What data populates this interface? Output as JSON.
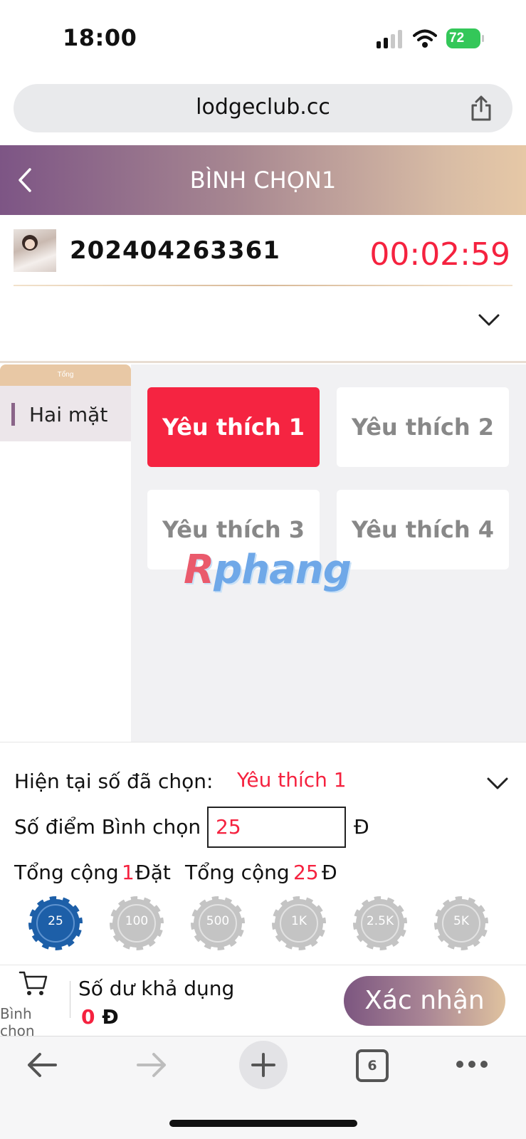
{
  "status_bar": {
    "time": "18:00",
    "battery": "72"
  },
  "browser": {
    "url": "lodgeclub.cc",
    "tab_count": "6"
  },
  "header": {
    "title": "BÌNH CHỌN1"
  },
  "round": {
    "id": "202404263361",
    "countdown": "00:02:59"
  },
  "sidebar": {
    "header": "Tổng",
    "items": [
      {
        "label": "Hai mặt"
      }
    ]
  },
  "options": [
    {
      "label": "Yêu thích 1",
      "selected": true
    },
    {
      "label": "Yêu thích 2",
      "selected": false
    },
    {
      "label": "Yêu thích 3",
      "selected": false
    },
    {
      "label": "Yêu thích 4",
      "selected": false
    }
  ],
  "watermark": {
    "first": "R",
    "rest": "phang"
  },
  "bet": {
    "selected_label": "Hiện tại số đã chọn:",
    "selected_value": "Yêu thích 1",
    "points_label": "Số điểm Bình chọn",
    "points_value": "25",
    "points_currency": "Đ",
    "total_prefix": "Tổng cộng",
    "total_count": "1",
    "total_count_unit": "Đặt",
    "total_amount_prefix": "Tổng cộng",
    "total_amount": "25",
    "total_amount_unit": "Đ"
  },
  "chips": [
    {
      "label": "25",
      "active": true
    },
    {
      "label": "100",
      "active": false
    },
    {
      "label": "500",
      "active": false
    },
    {
      "label": "1K",
      "active": false
    },
    {
      "label": "2.5K",
      "active": false
    },
    {
      "label": "5K",
      "active": false
    }
  ],
  "bottom": {
    "cart_label": "Bình chọn",
    "balance_label": "Số dư khả dụng",
    "balance_value": "0",
    "balance_unit": "Đ",
    "confirm_label": "Xác nhận"
  },
  "colors": {
    "accent_red": "#f5223f",
    "header_gradient_start": "#7d5585",
    "header_gradient_end": "#e6c8a6",
    "chip_active": "#1d5fa8",
    "chip_inactive": "#c4c4c4"
  },
  "icons": [
    "signal-icon",
    "wifi-icon",
    "share-icon",
    "back-icon",
    "chevron-down-icon",
    "cart-icon",
    "back-arrow-icon",
    "forward-arrow-icon",
    "plus-icon",
    "tabs-icon",
    "more-icon"
  ]
}
